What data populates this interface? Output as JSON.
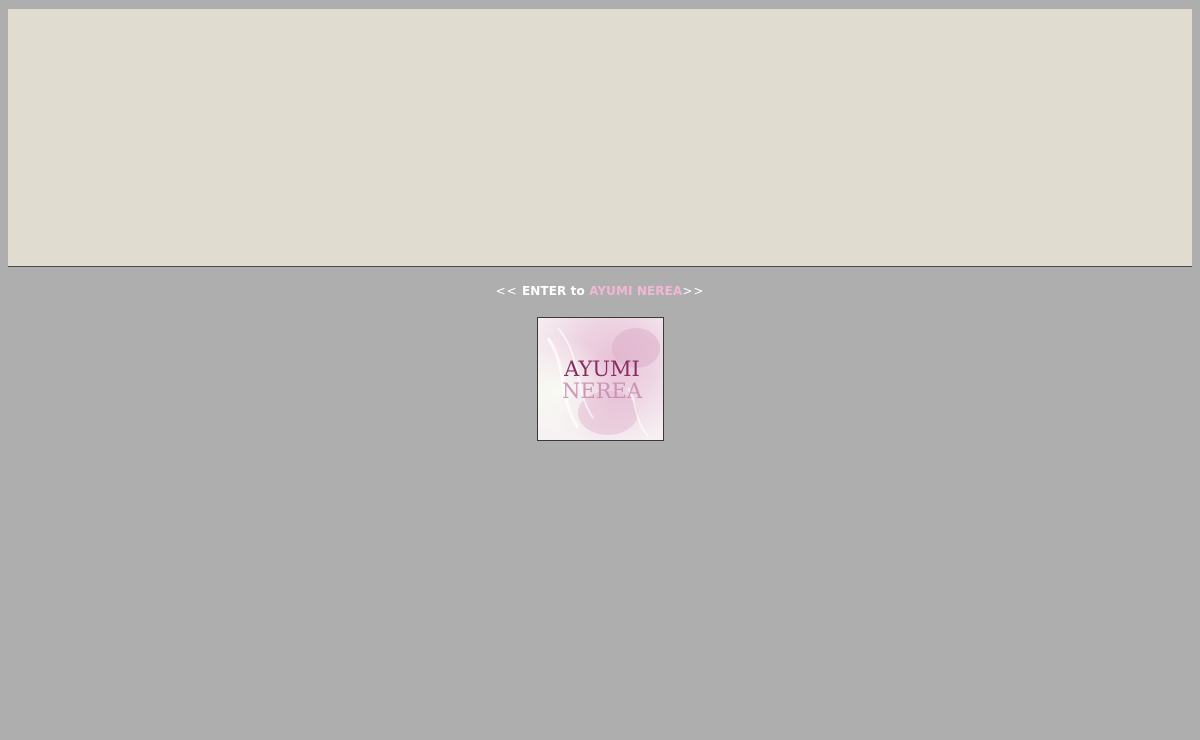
{
  "enter": {
    "arrow_left": "<<",
    "prefix": " ENTER to ",
    "site_name": "AYUMI NEREA",
    "arrow_right": ">>"
  },
  "thumbnail": {
    "logo_line1": "AYUMI",
    "logo_line2": "NEREA"
  },
  "colors": {
    "background": "#aeaeae",
    "banner": "#e0dcd0",
    "accent_pink": "#f3b6d6",
    "enter_text": "#ffffff"
  }
}
